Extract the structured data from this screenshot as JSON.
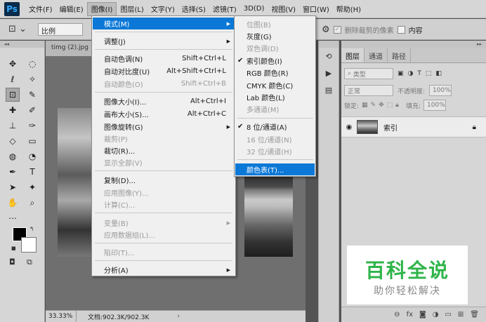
{
  "menubar": {
    "logo": "Ps",
    "items": [
      "文件(F)",
      "编辑(E)",
      "图像(I)",
      "图层(L)",
      "文字(Y)",
      "选择(S)",
      "滤镜(T)",
      "3D(D)",
      "视图(V)",
      "窗口(W)",
      "帮助(H)"
    ]
  },
  "options": {
    "ratio": "比例",
    "delete_cropped": "删除裁剪的像素",
    "content_aware": "内容"
  },
  "toolbar": {
    "collapse": "◂◂"
  },
  "document": {
    "tab_title": "timg (2).jpg",
    "zoom": "33.33%",
    "doc_size": "文档:902.3K/902.3K",
    "status_arrow": "›"
  },
  "image_menu": {
    "items": [
      {
        "label": "模式(M)",
        "shortcut": "",
        "submenu": true,
        "disabled": false,
        "highlighted": true
      },
      {
        "label": "调整(J)",
        "shortcut": "",
        "submenu": true,
        "disabled": false
      },
      {
        "label": "自动色调(N)",
        "shortcut": "Shift+Ctrl+L",
        "disabled": false
      },
      {
        "label": "自动对比度(U)",
        "shortcut": "Alt+Shift+Ctrl+L",
        "disabled": false
      },
      {
        "label": "自动颜色(O)",
        "shortcut": "Shift+Ctrl+B",
        "disabled": true
      },
      {
        "label": "图像大小(I)...",
        "shortcut": "Alt+Ctrl+I",
        "disabled": false
      },
      {
        "label": "画布大小(S)...",
        "shortcut": "Alt+Ctrl+C",
        "disabled": false
      },
      {
        "label": "图像旋转(G)",
        "shortcut": "",
        "submenu": true,
        "disabled": false
      },
      {
        "label": "裁剪(P)",
        "shortcut": "",
        "disabled": true
      },
      {
        "label": "裁切(R)...",
        "shortcut": "",
        "disabled": false
      },
      {
        "label": "显示全部(V)",
        "shortcut": "",
        "disabled": true
      },
      {
        "label": "复制(D)...",
        "shortcut": "",
        "disabled": false
      },
      {
        "label": "应用图像(Y)...",
        "shortcut": "",
        "disabled": true
      },
      {
        "label": "计算(C)...",
        "shortcut": "",
        "disabled": true
      },
      {
        "label": "变量(B)",
        "shortcut": "",
        "submenu": true,
        "disabled": true
      },
      {
        "label": "应用数据组(L)...",
        "shortcut": "",
        "disabled": true
      },
      {
        "label": "陷印(T)...",
        "shortcut": "",
        "disabled": true
      },
      {
        "label": "分析(A)",
        "shortcut": "",
        "submenu": true,
        "disabled": false
      }
    ]
  },
  "mode_menu": {
    "items": [
      {
        "label": "位图(B)",
        "disabled": true,
        "checked": false
      },
      {
        "label": "灰度(G)",
        "disabled": false,
        "checked": false
      },
      {
        "label": "双色调(D)",
        "disabled": true,
        "checked": false
      },
      {
        "label": "索引颜色(I)",
        "disabled": false,
        "checked": true
      },
      {
        "label": "RGB 颜色(R)",
        "disabled": false,
        "checked": false
      },
      {
        "label": "CMYK 颜色(C)",
        "disabled": false,
        "checked": false
      },
      {
        "label": "Lab 颜色(L)",
        "disabled": false,
        "checked": false
      },
      {
        "label": "多通道(M)",
        "disabled": true,
        "checked": false
      },
      {
        "label": "8 位/通道(A)",
        "disabled": false,
        "checked": true
      },
      {
        "label": "16 位/通道(N)",
        "disabled": true,
        "checked": false
      },
      {
        "label": "32 位/通道(H)",
        "disabled": true,
        "checked": false
      },
      {
        "label": "颜色表(T)...",
        "disabled": false,
        "checked": false,
        "highlighted": true
      }
    ]
  },
  "layers_panel": {
    "tabs": [
      "图层",
      "通道",
      "路径"
    ],
    "filter_kind": "类型",
    "blend_mode": "正常",
    "opacity_label": "不透明度:",
    "opacity_value": "100%",
    "lock_label": "锁定:",
    "fill_label": "填充:",
    "fill_value": "100%",
    "layer_name": "索引"
  },
  "watermark": {
    "title": "百科全说",
    "subtitle": "助你轻松解决"
  },
  "colors": {
    "menu_highlight": "#0b78d7",
    "watermark_green": "#2fb44a"
  }
}
